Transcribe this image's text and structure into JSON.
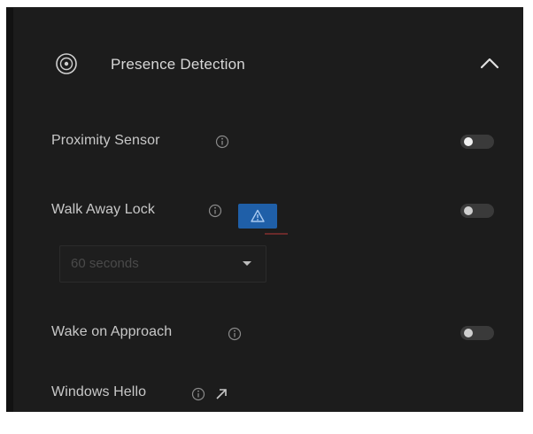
{
  "section": {
    "title": "Presence Detection",
    "icon": "presence-sensor-icon",
    "collapse_icon": "chevron-up-icon"
  },
  "settings": {
    "proximity": {
      "label": "Proximity Sensor",
      "enabled": true
    },
    "walk_away": {
      "label": "Walk Away Lock",
      "enabled": false,
      "badge_icon": "warning-icon",
      "select_value": "60 seconds"
    },
    "wake": {
      "label": "Wake on Approach",
      "enabled": false
    },
    "hello": {
      "label": "Windows Hello",
      "link_icon": "external-link-icon"
    }
  },
  "colors": {
    "panel": "#1c1c1c",
    "accent_blue": "#1f5fa8",
    "text": "#c8c8c8"
  }
}
